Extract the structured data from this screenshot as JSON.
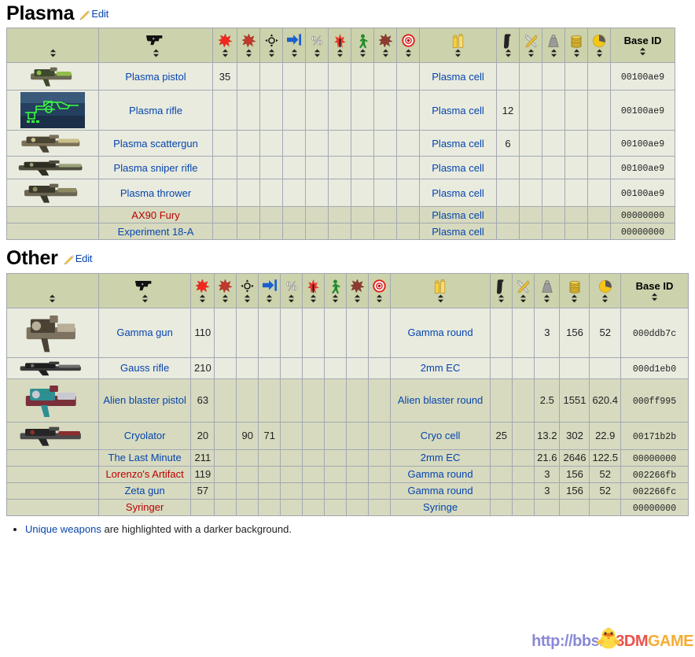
{
  "sections": [
    {
      "id": "plasma",
      "title": "Plasma",
      "edit_label": "Edit",
      "edit_icon": "pencil-icon",
      "columns": [
        {
          "key": "icon",
          "icon": "image-icon",
          "label": "",
          "sortable": true
        },
        {
          "key": "name",
          "icon": "pistol-icon",
          "label": "",
          "sortable": true
        },
        {
          "key": "dmg_bal",
          "icon": "red-starburst-icon",
          "label": "",
          "sortable": true
        },
        {
          "key": "dmg_ene",
          "icon": "dark-red-starburst-icon",
          "label": "",
          "sortable": true
        },
        {
          "key": "accuracy",
          "icon": "crosshair-icon",
          "label": "",
          "sortable": true
        },
        {
          "key": "range",
          "icon": "blue-arrow-icon",
          "label": "",
          "sortable": true
        },
        {
          "key": "percent",
          "icon": "percent-icon",
          "label": "",
          "sortable": true
        },
        {
          "key": "dmg_exp",
          "icon": "red-burst-icon",
          "label": "",
          "sortable": true
        },
        {
          "key": "dmg_rad",
          "icon": "green-figure-icon",
          "label": "",
          "sortable": true
        },
        {
          "key": "dmg_poi",
          "icon": "dark-burst-icon",
          "label": "",
          "sortable": true
        },
        {
          "key": "crit",
          "icon": "target-icon",
          "label": "",
          "sortable": true
        },
        {
          "key": "ammo",
          "icon": "ammo-boxes-icon",
          "label": "",
          "sortable": true
        },
        {
          "key": "mag",
          "icon": "magazine-icon",
          "label": "",
          "sortable": true
        },
        {
          "key": "mods",
          "icon": "tools-icon",
          "label": "",
          "sortable": true
        },
        {
          "key": "weight",
          "icon": "weight-icon",
          "label": "",
          "sortable": true
        },
        {
          "key": "value",
          "icon": "caps-stack-icon",
          "label": "",
          "sortable": true
        },
        {
          "key": "ratio",
          "icon": "pie-chart-icon",
          "label": "",
          "sortable": true
        },
        {
          "key": "baseid",
          "icon": "",
          "label": "Base ID",
          "sortable": true
        }
      ],
      "rows": [
        {
          "unique": false,
          "icon": "plasma-pistol-image",
          "name": "Plasma pistol",
          "name_style": "link",
          "dmg_bal": "35",
          "dmg_ene": "",
          "accuracy": "",
          "range": "",
          "percent": "",
          "dmg_exp": "",
          "dmg_rad": "",
          "dmg_poi": "",
          "crit": "",
          "ammo": "Plasma cell",
          "ammo_style": "link",
          "mag": "",
          "mods": "",
          "weight": "",
          "value": "",
          "ratio": "",
          "baseid": "00100ae9"
        },
        {
          "unique": false,
          "icon": "plasma-rifle-image",
          "name": "Plasma rifle",
          "name_style": "link",
          "dmg_bal": "",
          "dmg_ene": "",
          "accuracy": "",
          "range": "",
          "percent": "",
          "dmg_exp": "",
          "dmg_rad": "",
          "dmg_poi": "",
          "crit": "",
          "ammo": "Plasma cell",
          "ammo_style": "link",
          "mag": "12",
          "mods": "",
          "weight": "",
          "value": "",
          "ratio": "",
          "baseid": "00100ae9"
        },
        {
          "unique": false,
          "icon": "plasma-scattergun-image",
          "name": "Plasma scattergun",
          "name_style": "link",
          "dmg_bal": "",
          "dmg_ene": "",
          "accuracy": "",
          "range": "",
          "percent": "",
          "dmg_exp": "",
          "dmg_rad": "",
          "dmg_poi": "",
          "crit": "",
          "ammo": "Plasma cell",
          "ammo_style": "link",
          "mag": "6",
          "mods": "",
          "weight": "",
          "value": "",
          "ratio": "",
          "baseid": "00100ae9"
        },
        {
          "unique": false,
          "icon": "plasma-sniper-rifle-image",
          "name": "Plasma sniper rifle",
          "name_style": "link",
          "dmg_bal": "",
          "dmg_ene": "",
          "accuracy": "",
          "range": "",
          "percent": "",
          "dmg_exp": "",
          "dmg_rad": "",
          "dmg_poi": "",
          "crit": "",
          "ammo": "Plasma cell",
          "ammo_style": "link",
          "mag": "",
          "mods": "",
          "weight": "",
          "value": "",
          "ratio": "",
          "baseid": "00100ae9"
        },
        {
          "unique": false,
          "icon": "plasma-thrower-image",
          "name": "Plasma thrower",
          "name_style": "link",
          "dmg_bal": "",
          "dmg_ene": "",
          "accuracy": "",
          "range": "",
          "percent": "",
          "dmg_exp": "",
          "dmg_rad": "",
          "dmg_poi": "",
          "crit": "",
          "ammo": "Plasma cell",
          "ammo_style": "link",
          "mag": "",
          "mods": "",
          "weight": "",
          "value": "",
          "ratio": "",
          "baseid": "00100ae9"
        },
        {
          "unique": true,
          "icon": "",
          "name": "AX90 Fury",
          "name_style": "red",
          "dmg_bal": "",
          "dmg_ene": "",
          "accuracy": "",
          "range": "",
          "percent": "",
          "dmg_exp": "",
          "dmg_rad": "",
          "dmg_poi": "",
          "crit": "",
          "ammo": "Plasma cell",
          "ammo_style": "link",
          "mag": "",
          "mods": "",
          "weight": "",
          "value": "",
          "ratio": "",
          "baseid": "00000000"
        },
        {
          "unique": true,
          "icon": "",
          "name": "Experiment 18-A",
          "name_style": "link",
          "dmg_bal": "",
          "dmg_ene": "",
          "accuracy": "",
          "range": "",
          "percent": "",
          "dmg_exp": "",
          "dmg_rad": "",
          "dmg_poi": "",
          "crit": "",
          "ammo": "Plasma cell",
          "ammo_style": "link",
          "mag": "",
          "mods": "",
          "weight": "",
          "value": "",
          "ratio": "",
          "baseid": "00000000"
        }
      ]
    },
    {
      "id": "other",
      "title": "Other",
      "edit_label": "Edit",
      "edit_icon": "pencil-icon",
      "columns": [
        {
          "key": "icon",
          "icon": "image-icon",
          "label": "",
          "sortable": true
        },
        {
          "key": "name",
          "icon": "pistol-icon",
          "label": "",
          "sortable": true
        },
        {
          "key": "dmg_bal",
          "icon": "red-starburst-icon",
          "label": "",
          "sortable": true
        },
        {
          "key": "dmg_ene",
          "icon": "dark-red-starburst-icon",
          "label": "",
          "sortable": true
        },
        {
          "key": "accuracy",
          "icon": "crosshair-icon",
          "label": "",
          "sortable": true
        },
        {
          "key": "range",
          "icon": "blue-arrow-icon",
          "label": "",
          "sortable": true
        },
        {
          "key": "percent",
          "icon": "percent-icon",
          "label": "",
          "sortable": true
        },
        {
          "key": "dmg_exp",
          "icon": "red-burst-icon",
          "label": "",
          "sortable": true
        },
        {
          "key": "dmg_rad",
          "icon": "green-figure-icon",
          "label": "",
          "sortable": true
        },
        {
          "key": "dmg_poi",
          "icon": "dark-burst-icon",
          "label": "",
          "sortable": true
        },
        {
          "key": "crit",
          "icon": "target-icon",
          "label": "",
          "sortable": true
        },
        {
          "key": "ammo",
          "icon": "ammo-boxes-icon",
          "label": "",
          "sortable": true
        },
        {
          "key": "mag",
          "icon": "magazine-icon",
          "label": "",
          "sortable": true
        },
        {
          "key": "mods",
          "icon": "tools-icon",
          "label": "",
          "sortable": true
        },
        {
          "key": "weight",
          "icon": "weight-icon",
          "label": "",
          "sortable": true
        },
        {
          "key": "value",
          "icon": "caps-stack-icon",
          "label": "",
          "sortable": true
        },
        {
          "key": "ratio",
          "icon": "pie-chart-icon",
          "label": "",
          "sortable": true
        },
        {
          "key": "baseid",
          "icon": "",
          "label": "Base ID",
          "sortable": true
        }
      ],
      "rows": [
        {
          "unique": false,
          "icon": "gamma-gun-image",
          "name": "Gamma gun",
          "name_style": "link",
          "dmg_bal": "110",
          "dmg_ene": "",
          "accuracy": "",
          "range": "",
          "percent": "",
          "dmg_exp": "",
          "dmg_rad": "",
          "dmg_poi": "",
          "crit": "",
          "ammo": "Gamma round",
          "ammo_style": "link",
          "mag": "",
          "mods": "",
          "weight": "3",
          "value": "156",
          "ratio": "52",
          "baseid": "000ddb7c"
        },
        {
          "unique": false,
          "icon": "gauss-rifle-image",
          "name": "Gauss rifle",
          "name_style": "link",
          "dmg_bal": "210",
          "dmg_ene": "",
          "accuracy": "",
          "range": "",
          "percent": "",
          "dmg_exp": "",
          "dmg_rad": "",
          "dmg_poi": "",
          "crit": "",
          "ammo": "2mm EC",
          "ammo_style": "link",
          "mag": "",
          "mods": "",
          "weight": "",
          "value": "",
          "ratio": "",
          "baseid": "000d1eb0"
        },
        {
          "unique": true,
          "icon": "alien-blaster-pistol-image",
          "name": "Alien blaster pistol",
          "name_style": "link",
          "dmg_bal": "63",
          "dmg_ene": "",
          "accuracy": "",
          "range": "",
          "percent": "",
          "dmg_exp": "",
          "dmg_rad": "",
          "dmg_poi": "",
          "crit": "",
          "ammo": "Alien blaster round",
          "ammo_style": "link",
          "mag": "",
          "mods": "",
          "weight": "2.5",
          "value": "1551",
          "ratio": "620.4",
          "baseid": "000ff995"
        },
        {
          "unique": true,
          "icon": "cryolator-image",
          "name": "Cryolator",
          "name_style": "link",
          "dmg_bal": "20",
          "dmg_ene": "",
          "accuracy": "90",
          "range": "71",
          "percent": "",
          "dmg_exp": "",
          "dmg_rad": "",
          "dmg_poi": "",
          "crit": "",
          "ammo": "Cryo cell",
          "ammo_style": "link",
          "mag": "25",
          "mods": "",
          "weight": "13.2",
          "value": "302",
          "ratio": "22.9",
          "baseid": "00171b2b"
        },
        {
          "unique": true,
          "icon": "",
          "name": "The Last Minute",
          "name_style": "link",
          "dmg_bal": "211",
          "dmg_ene": "",
          "accuracy": "",
          "range": "",
          "percent": "",
          "dmg_exp": "",
          "dmg_rad": "",
          "dmg_poi": "",
          "crit": "",
          "ammo": "2mm EC",
          "ammo_style": "link",
          "mag": "",
          "mods": "",
          "weight": "21.6",
          "value": "2646",
          "ratio": "122.5",
          "baseid": "00000000"
        },
        {
          "unique": true,
          "icon": "",
          "name": "Lorenzo's Artifact",
          "name_style": "red",
          "dmg_bal": "119",
          "dmg_ene": "",
          "accuracy": "",
          "range": "",
          "percent": "",
          "dmg_exp": "",
          "dmg_rad": "",
          "dmg_poi": "",
          "crit": "",
          "ammo": "Gamma round",
          "ammo_style": "link",
          "mag": "",
          "mods": "",
          "weight": "3",
          "value": "156",
          "ratio": "52",
          "baseid": "002266fb"
        },
        {
          "unique": true,
          "icon": "",
          "name": "Zeta gun",
          "name_style": "link",
          "dmg_bal": "57",
          "dmg_ene": "",
          "accuracy": "",
          "range": "",
          "percent": "",
          "dmg_exp": "",
          "dmg_rad": "",
          "dmg_poi": "",
          "crit": "",
          "ammo": "Gamma round",
          "ammo_style": "link",
          "mag": "",
          "mods": "",
          "weight": "3",
          "value": "156",
          "ratio": "52",
          "baseid": "002266fc"
        },
        {
          "unique": true,
          "icon": "",
          "name": "Syringer",
          "name_style": "red",
          "dmg_bal": "",
          "dmg_ene": "",
          "accuracy": "",
          "range": "",
          "percent": "",
          "dmg_exp": "",
          "dmg_rad": "",
          "dmg_poi": "",
          "crit": "",
          "ammo": "Syringe",
          "ammo_style": "link",
          "mag": "",
          "mods": "",
          "weight": "",
          "value": "",
          "ratio": "",
          "baseid": "00000000"
        }
      ]
    }
  ],
  "footer": {
    "note_link": "Unique weapons",
    "note_rest": " are highlighted with a darker background."
  },
  "watermark": {
    "url": "http://bbs.",
    "brand_a": "3DM",
    "brand_b": "GAME",
    "icon": "chick-icon"
  },
  "colors": {
    "header_bg": "#ccd2ab",
    "row_bg": "#e9ebdf",
    "unique_row_bg": "#d7dabf",
    "border": "#a2a9b1",
    "link": "#0645ad",
    "red_link": "#ba0000"
  }
}
